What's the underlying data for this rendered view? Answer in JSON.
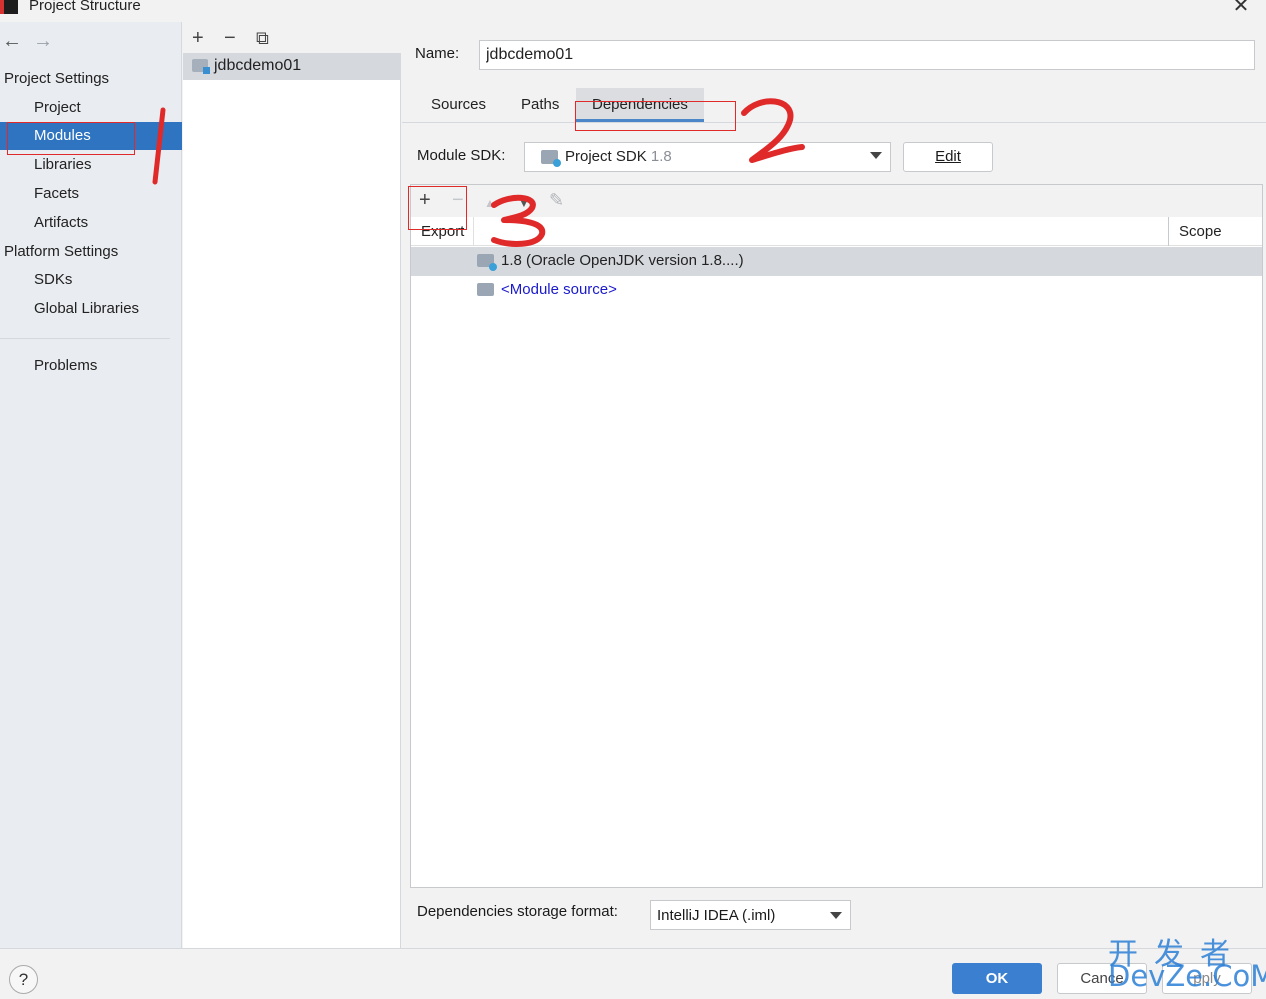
{
  "window": {
    "title": "Project Structure",
    "close_glyph": "✕"
  },
  "nav": {
    "back_glyph": "←",
    "forward_glyph": "→",
    "project_settings_heading": "Project Settings",
    "project_settings_items": [
      "Project",
      "Modules",
      "Libraries",
      "Facets",
      "Artifacts"
    ],
    "selected_item": "Modules",
    "platform_settings_heading": "Platform Settings",
    "platform_settings_items": [
      "SDKs",
      "Global Libraries"
    ],
    "problems": "Problems"
  },
  "modules": {
    "toolbar": {
      "add_glyph": "+",
      "remove_glyph": "−",
      "copy_glyph": "⧉"
    },
    "items": [
      "jdbcdemo01"
    ]
  },
  "module": {
    "name_label": "Name:",
    "name_value": "jdbcdemo01",
    "tabs": [
      "Sources",
      "Paths",
      "Dependencies"
    ],
    "active_tab": "Dependencies",
    "sdk_label": "Module SDK:",
    "sdk_value": "Project SDK",
    "sdk_version": "1.8",
    "edit_button": "Edit"
  },
  "dependencies": {
    "toolbar": {
      "add_glyph": "+",
      "remove_glyph": "−",
      "up_glyph": "▲",
      "down_glyph": "▼",
      "edit_glyph": "✎"
    },
    "columns": {
      "export": "Export",
      "scope": "Scope"
    },
    "rows": [
      {
        "label": "1.8 (Oracle OpenJDK version 1.8....)",
        "selected": true
      },
      {
        "label": "<Module source>",
        "selected": false
      }
    ],
    "storage_label": "Dependencies storage format:",
    "storage_value": "IntelliJ IDEA (.iml)"
  },
  "footer": {
    "help_glyph": "?",
    "ok": "OK",
    "cancel": "Cance",
    "apply": "pply"
  },
  "annotations": {
    "color": "#e02a2a",
    "labels": [
      "1",
      "2",
      "3"
    ]
  },
  "watermark": {
    "line1": "开发者",
    "line2": "DevZe.CoM"
  },
  "colors": {
    "selection_blue": "#2f74c0",
    "ok_button": "#3a7fd0",
    "link_blue": "#1a1acc",
    "tab_underline": "#4a86c8"
  }
}
